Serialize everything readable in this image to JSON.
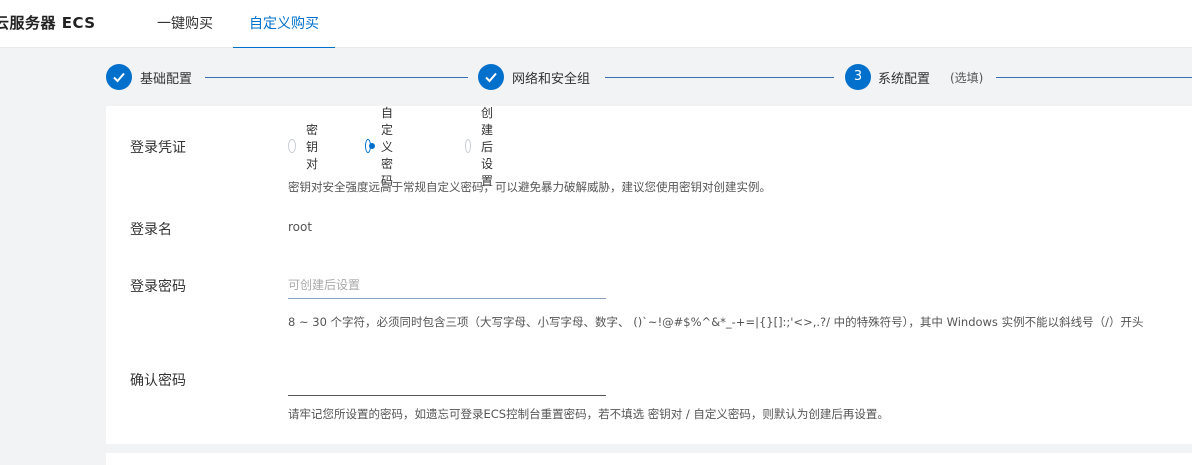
{
  "header": {
    "brand": "云服务器 ECS",
    "tabs": [
      {
        "label": "一键购买",
        "active": false
      },
      {
        "label": "自定义购买",
        "active": true
      }
    ]
  },
  "steps": [
    {
      "index": "1",
      "label": "基础配置",
      "done": true
    },
    {
      "index": "2",
      "label": "网络和安全组",
      "done": true
    },
    {
      "index": "3",
      "label": "系统配置",
      "done": false,
      "optional": "(选填)"
    }
  ],
  "form": {
    "credential": {
      "label": "登录凭证",
      "options": [
        "密钥对",
        "自定义密码",
        "创建后设置"
      ],
      "selected": "自定义密码",
      "hint": "密钥对安全强度远高于常规自定义密码，可以避免暴力破解威胁，建议您使用密钥对创建实例。"
    },
    "login_name": {
      "label": "登录名",
      "value": "root"
    },
    "password": {
      "label": "登录密码",
      "value": "",
      "placeholder": "可创建后设置",
      "hint": "8 ~ 30 个字符，必须同时包含三项（大写字母、小写字母、数字、 ()`~!@#$%^&*_-+=|{}[]:;'<>,.?/ 中的特殊符号），其中 Windows 实例不能以斜线号（/）开头"
    },
    "confirm_password": {
      "label": "确认密码",
      "value": "",
      "placeholder": "",
      "hint": "请牢记您所设置的密码，如遗忘可登录ECS控制台重置密码，若不填选 密钥对 / 自定义密码，则默认为创建后再设置。"
    }
  },
  "colors": {
    "accent": "#0070cc",
    "background": "#f2f3f5",
    "panel": "#ffffff"
  }
}
